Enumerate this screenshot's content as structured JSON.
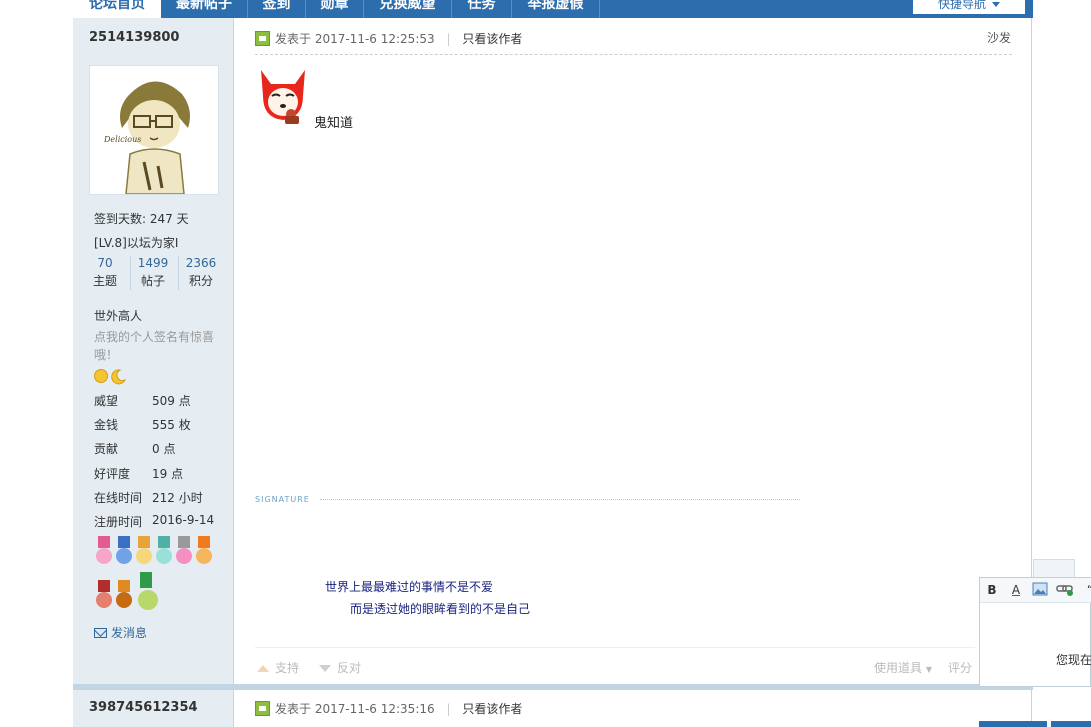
{
  "nav": {
    "items": [
      "论坛首页",
      "最新帖子",
      "签到",
      "勋章",
      "兑换威望",
      "任务",
      "举报虚假"
    ],
    "quick_nav": "快捷导航"
  },
  "post1": {
    "username": "2514139800",
    "checkin": "签到天数: 247 天",
    "level": "[LV.8]以坛为家I",
    "stats": [
      {
        "num": "70",
        "label": "主题"
      },
      {
        "num": "1499",
        "label": "帖子"
      },
      {
        "num": "2366",
        "label": "积分"
      }
    ],
    "title": "世外高人",
    "signature_hint": "点我的个人签名有惊喜哦！",
    "info": [
      {
        "k": "威望",
        "v": "509 点"
      },
      {
        "k": "金钱",
        "v": "555 枚"
      },
      {
        "k": "贡献",
        "v": "0 点"
      },
      {
        "k": "好评度",
        "v": "19 点"
      },
      {
        "k": "在线时间",
        "v": "212 小时"
      },
      {
        "k": "注册时间",
        "v": "2016-9-14"
      }
    ],
    "send_msg": "发消息",
    "posted": "发表于 2017-11-6 12:25:53",
    "only_author": "只看该作者",
    "floor": "沙发",
    "body": "鬼知道",
    "signature_label": "SIGNATURE",
    "sig_line1": "世界上最最难过的事情不是不爱",
    "sig_line2": "而是透过她的眼眸看到的不是自己",
    "support": "支持",
    "oppose": "反对",
    "use_tool": "使用道具",
    "rate": "评分"
  },
  "post2": {
    "username": "398745612354",
    "posted": "发表于 2017-11-6 12:35:16",
    "only_author": "只看该作者"
  },
  "editor": {
    "bold": "B",
    "font_color": "A",
    "hint": "您现在"
  },
  "colors": {
    "nav_bg": "#2b6dad",
    "sidebar_bg": "#e5edf2",
    "link": "#336699"
  }
}
